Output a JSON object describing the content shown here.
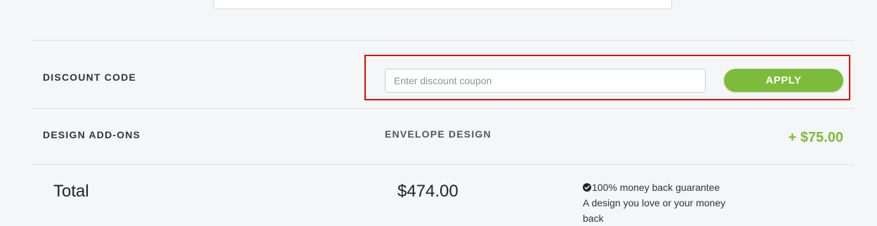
{
  "discount": {
    "label": "DISCOUNT CODE",
    "input_placeholder": "Enter discount coupon",
    "input_value": "",
    "apply_label": "APPLY"
  },
  "addons": {
    "label": "DESIGN ADD-ONS",
    "item_name": "ENVELOPE DESIGN",
    "item_price": "+ $75.00"
  },
  "total": {
    "label": "Total",
    "value": "$474.00"
  },
  "guarantee": {
    "line1": "100% money back guarantee",
    "line2": "A design you love or your money back",
    "icon": "check-circle-icon"
  },
  "colors": {
    "accent_green": "#7dbb3a",
    "highlight_red": "#e10600",
    "background": "#f5f6f8"
  }
}
